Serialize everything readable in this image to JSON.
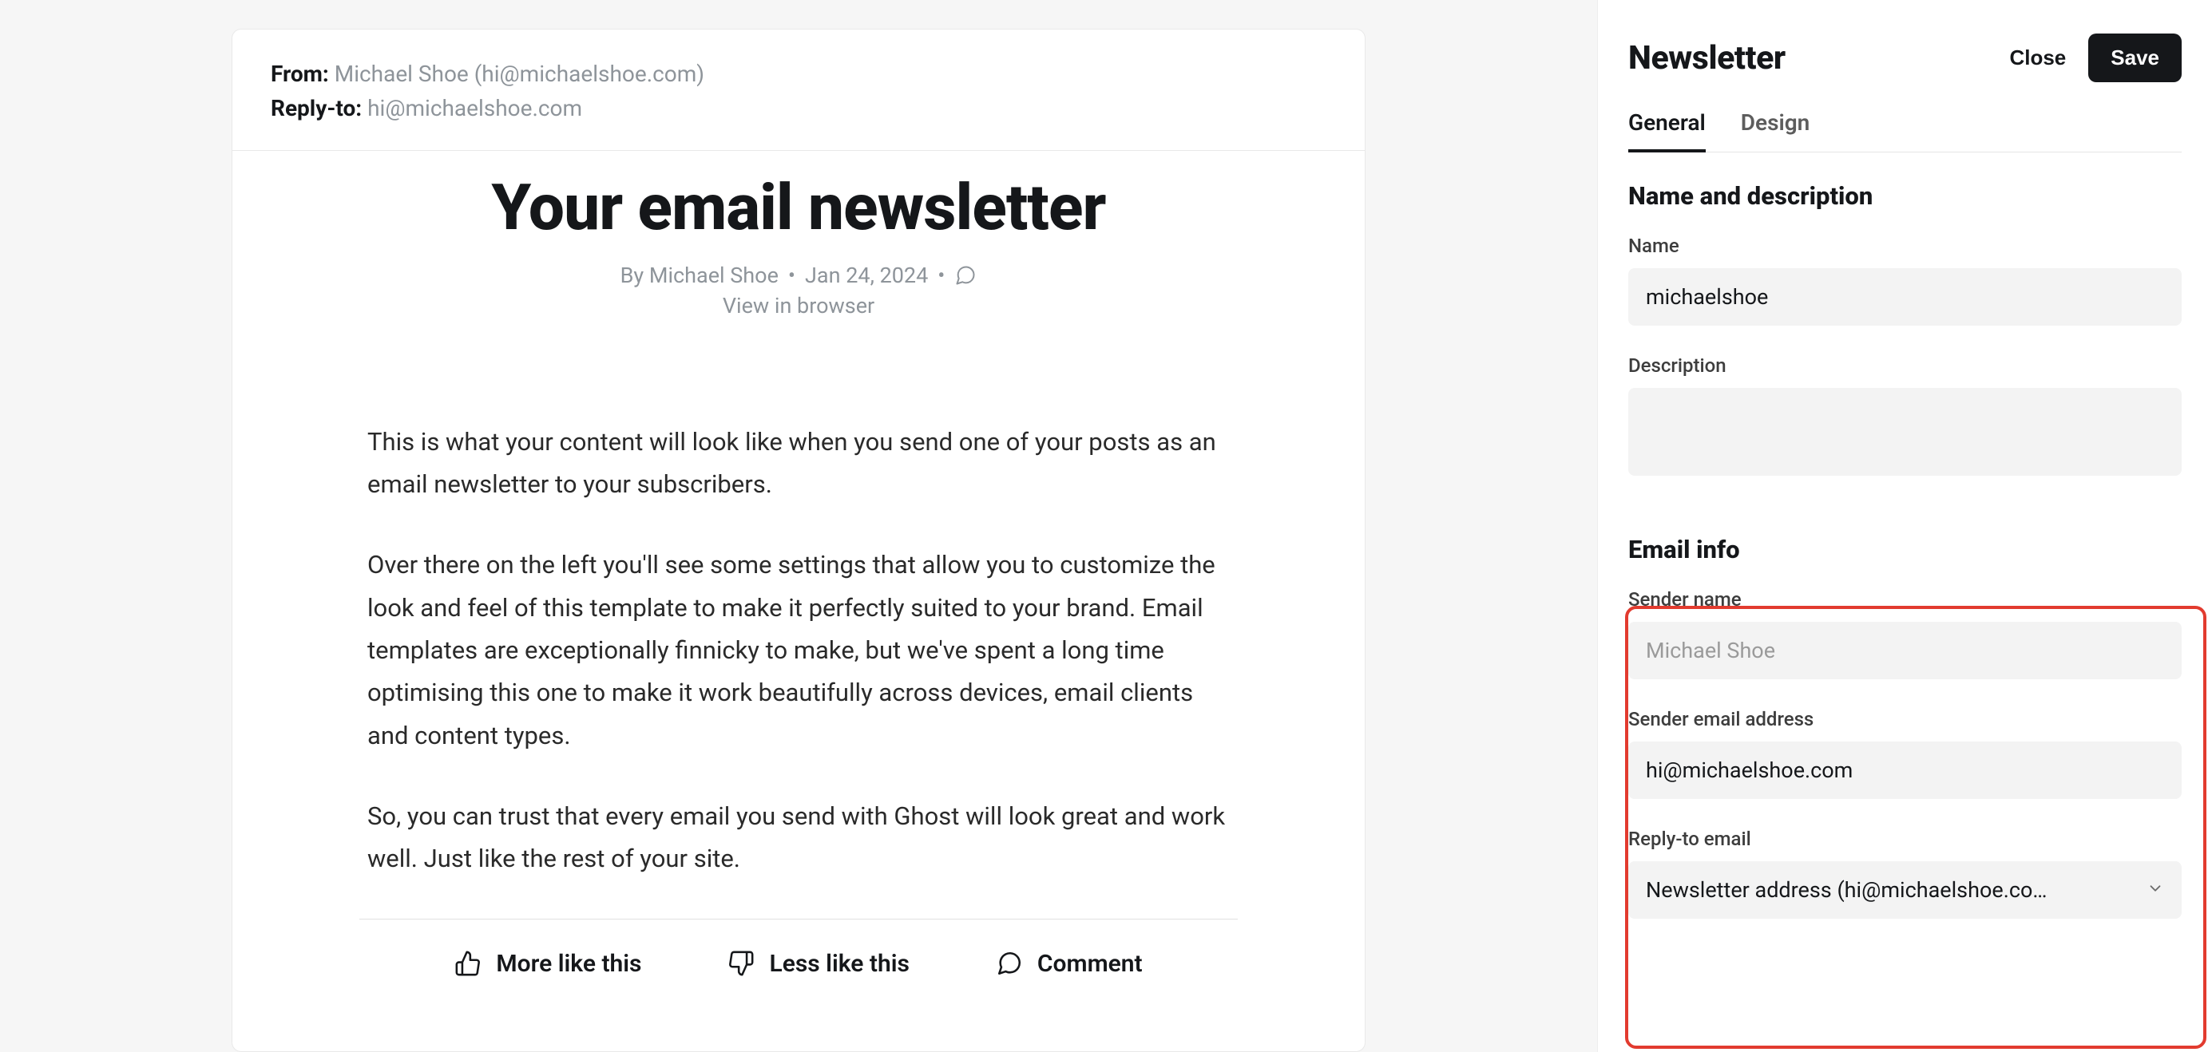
{
  "preview": {
    "from_label": "From:",
    "from_value": "Michael Shoe (hi@michaelshoe.com)",
    "reply_to_label": "Reply-to:",
    "reply_to_value": "hi@michaelshoe.com",
    "title": "Your email newsletter",
    "byline_author": "By Michael Shoe",
    "byline_date": "Jan 24, 2024",
    "view_in_browser": "View in browser",
    "para1": "This is what your content will look like when you send one of your posts as an email newsletter to your subscribers.",
    "para2": "Over there on the left you'll see some settings that allow you to customize the look and feel of this template to make it perfectly suited to your brand. Email templates are exceptionally finnicky to make, but we've spent a long time optimising this one to make it work beautifully across devices, email clients and content types.",
    "para3": "So, you can trust that every email you send with Ghost will look great and work well. Just like the rest of your site.",
    "actions": {
      "more": "More like this",
      "less": "Less like this",
      "comment": "Comment"
    }
  },
  "panel": {
    "title": "Newsletter",
    "close": "Close",
    "save": "Save",
    "tabs": {
      "general": "General",
      "design": "Design"
    },
    "section_name_desc": "Name and description",
    "name_label": "Name",
    "name_value": "michaelshoe",
    "description_label": "Description",
    "description_value": "",
    "section_email_info": "Email info",
    "sender_name_label": "Sender name",
    "sender_name_placeholder": "Michael Shoe",
    "sender_name_value": "",
    "sender_email_label": "Sender email address",
    "sender_email_value": "hi@michaelshoe.com",
    "reply_to_label": "Reply-to email",
    "reply_to_value": "Newsletter address (hi@michaelshoe.co…"
  }
}
